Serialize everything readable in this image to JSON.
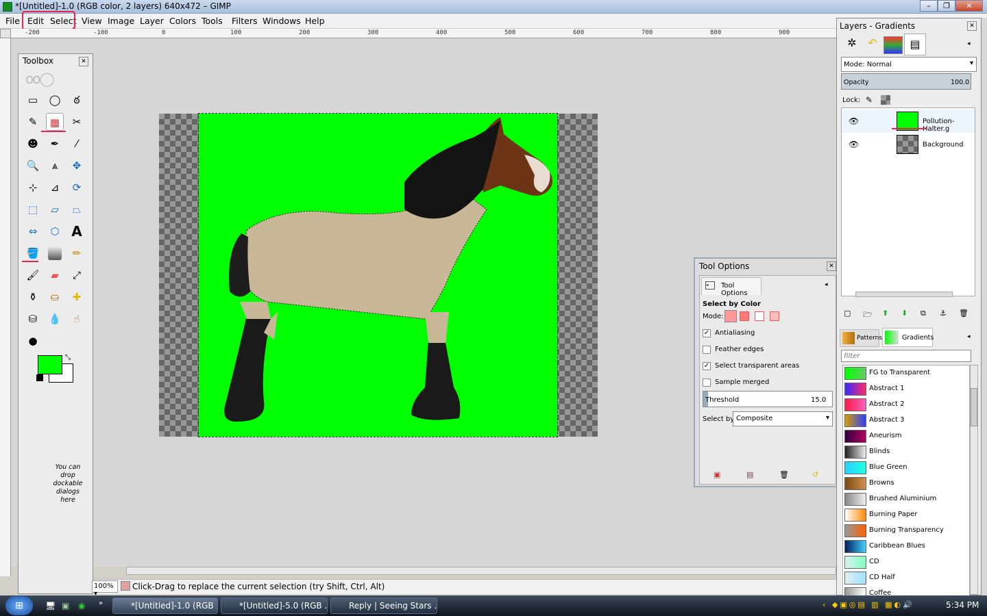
{
  "window": {
    "title": "*[Untitled]-1.0 (RGB color, 2 layers) 640x472 – GIMP"
  },
  "menu": [
    "File",
    "Edit",
    "Select",
    "View",
    "Image",
    "Layer",
    "Colors",
    "Tools",
    "Filters",
    "Windows",
    "Help"
  ],
  "ruler": {
    "ticks": [
      "-200",
      "-100",
      "0",
      "100",
      "200",
      "300",
      "400",
      "500",
      "600",
      "700",
      "800",
      "900"
    ]
  },
  "toolbox": {
    "title": "Toolbox",
    "drop_hint": "You can drop dockable dialogs here"
  },
  "colors": {
    "fg": "#00ff00",
    "bg": "#ffffff",
    "accent": "#e8244f"
  },
  "status": {
    "zoom": "100%",
    "message": "Click-Drag to replace the current selection (try Shift, Ctrl, Alt)"
  },
  "tool_options": {
    "window_title": "Tool Options",
    "tab_label": "Tool Options",
    "tool_name": "Select by Color",
    "mode_label": "Mode:",
    "antialiasing": {
      "label": "Antialiasing",
      "checked": true
    },
    "feather": {
      "label": "Feather edges",
      "checked": false
    },
    "transparent": {
      "label": "Select transparent areas",
      "checked": true
    },
    "merged": {
      "label": "Sample merged",
      "checked": false
    },
    "threshold": {
      "label": "Threshold",
      "value": "15.0"
    },
    "select_by": {
      "label": "Select by:",
      "value": "Composite"
    }
  },
  "layers": {
    "title": "Layers - Gradients",
    "mode_label": "Mode: Normal",
    "opacity_label": "Opacity",
    "opacity_value": "100.0",
    "lock_label": "Lock:",
    "items": [
      {
        "name": "Pollution-Halter.g",
        "visible": true
      },
      {
        "name": "Background",
        "visible": true
      }
    ]
  },
  "gradients": {
    "tabs": [
      "Patterns",
      "Gradients"
    ],
    "filter_placeholder": "filter",
    "items": [
      {
        "name": "FG to Transparent",
        "c1": "#00ff00",
        "c2": "#66cc66"
      },
      {
        "name": "Abstract 1",
        "c1": "#3a2aff",
        "c2": "#ff2a6a"
      },
      {
        "name": "Abstract 2",
        "c1": "#ff1a4a",
        "c2": "#ff60c0"
      },
      {
        "name": "Abstract 3",
        "c1": "#d4a000",
        "c2": "#2a40ff"
      },
      {
        "name": "Aneurism",
        "c1": "#300040",
        "c2": "#b00060"
      },
      {
        "name": "Blinds",
        "c1": "#222222",
        "c2": "#eeeeee"
      },
      {
        "name": "Blue Green",
        "c1": "#2ad0ff",
        "c2": "#20ffe0"
      },
      {
        "name": "Browns",
        "c1": "#7a4a10",
        "c2": "#d09050"
      },
      {
        "name": "Brushed Aluminium",
        "c1": "#888888",
        "c2": "#f0f0f0"
      },
      {
        "name": "Burning Paper",
        "c1": "#ffffff",
        "c2": "#ff8800"
      },
      {
        "name": "Burning Transparency",
        "c1": "#999999",
        "c2": "#ff6000"
      },
      {
        "name": "Caribbean Blues",
        "c1": "#002060",
        "c2": "#40d0ff"
      },
      {
        "name": "CD",
        "c1": "#d8f0f0",
        "c2": "#80ffc0"
      },
      {
        "name": "CD Half",
        "c1": "#e0f0f0",
        "c2": "#a0e0ff"
      },
      {
        "name": "Coffee",
        "c1": "#999999",
        "c2": "#ffffff"
      }
    ]
  },
  "taskbar": {
    "items": [
      "*[Untitled]-1.0 (RGB ...",
      "*[Untitled]-5.0 (RGB ...",
      "Reply | Seeing Stars ..."
    ],
    "clock": "5:34 PM"
  }
}
